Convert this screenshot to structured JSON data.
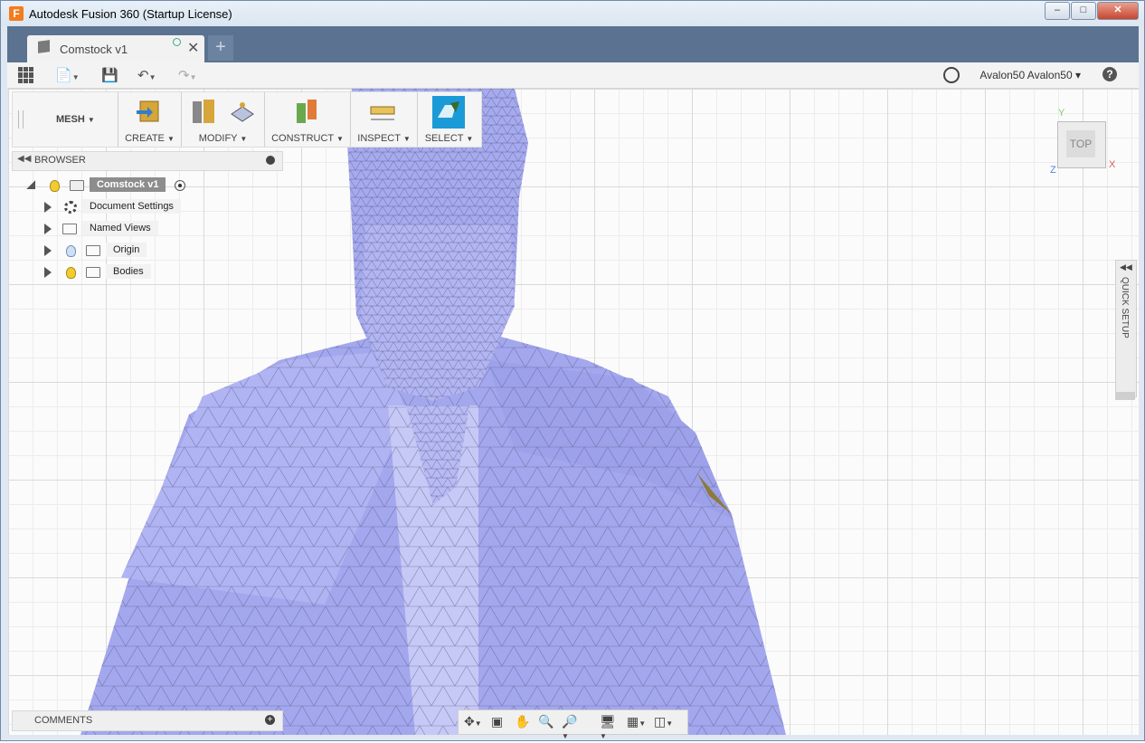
{
  "window": {
    "title": "Autodesk Fusion 360 (Startup License)",
    "app_icon": "F"
  },
  "tabs": [
    {
      "label": "Comstock v1"
    }
  ],
  "qat": {
    "user": "Avalon50 Avalon50 ▾"
  },
  "toolbar": {
    "workspace": "MESH",
    "groups": [
      {
        "label": "CREATE"
      },
      {
        "label": "MODIFY"
      },
      {
        "label": "CONSTRUCT"
      },
      {
        "label": "INSPECT"
      },
      {
        "label": "SELECT"
      }
    ]
  },
  "browser": {
    "title": "BROWSER",
    "root": "Comstock v1",
    "items": [
      {
        "label": "Document Settings"
      },
      {
        "label": "Named Views"
      },
      {
        "label": "Origin"
      },
      {
        "label": "Bodies"
      }
    ]
  },
  "viewcube": {
    "face": "TOP",
    "axes": {
      "x": "X",
      "y": "Y",
      "z": "Z"
    },
    "colors": {
      "x": "#e05a5a",
      "y": "#7fcf6f",
      "z": "#5a7fe0"
    }
  },
  "quick_setup": {
    "label": "QUICK SETUP"
  },
  "comments": {
    "title": "COMMENTS"
  },
  "colors": {
    "mesh": "#a3a7ee",
    "tabstrip": "#5b7390"
  }
}
